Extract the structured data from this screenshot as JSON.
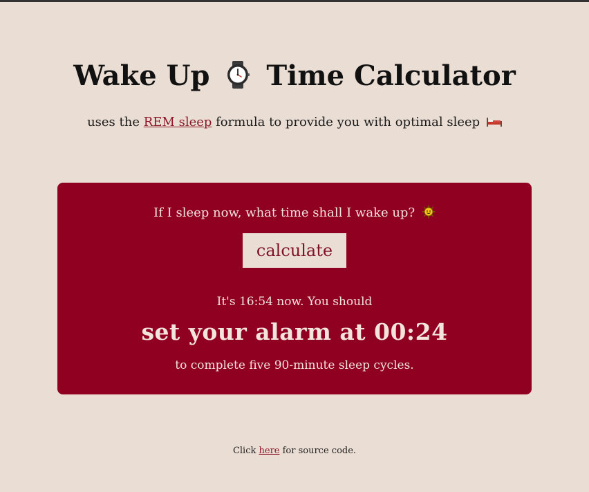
{
  "header": {
    "title_part1": "Wake Up",
    "title_icon": "watch-icon",
    "title_part2": "Time Calculator",
    "subtitle_prefix": "uses the ",
    "subtitle_link": "REM sleep",
    "subtitle_suffix": " formula to provide you with optimal sleep",
    "subtitle_icon": "bed-icon"
  },
  "card": {
    "question": "If I sleep now, what time shall I wake up?",
    "question_icon": "sun-icon",
    "button_label": "calculate",
    "now_line": "It's 16:54 now. You should",
    "alarm_line": "set your alarm at 00:24",
    "cycles_line": "to complete five 90-minute sleep cycles."
  },
  "footer": {
    "prefix": "Click ",
    "link": "here",
    "suffix": " for source code."
  },
  "colors": {
    "background": "#eaddd4",
    "card": "#900020",
    "link": "#8c1a2a",
    "button_bg": "#eaddd4",
    "button_text": "#7d1426"
  }
}
